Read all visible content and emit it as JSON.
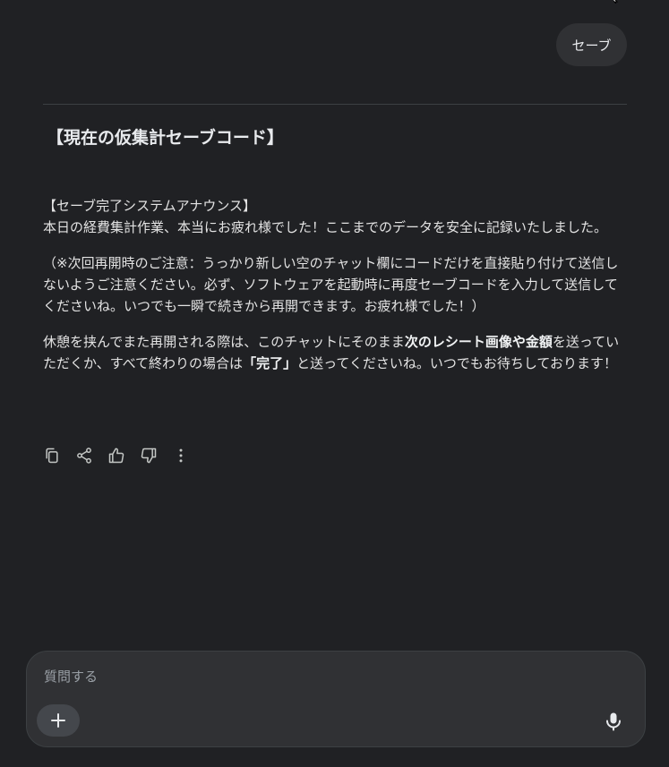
{
  "user_message": {
    "text": "セーブ"
  },
  "response": {
    "heading": "【現在の仮集計セーブコード】",
    "announce_title": "【セーブ完了システムアナウンス】",
    "announce_body": "本日の経費集計作業、本当にお疲れ様でした！ここまでのデータを安全に記録いたしました。",
    "note": "（※次回再開時のご注意：うっかり新しい空のチャット欄にコードだけを直接貼り付けて送信しないようご注意ください。必ず、ソフトウェアを起動時に再度セーブコードを入力して送信してくださいね。いつでも一瞬で続きから再開できます。お疲れ様でした！）",
    "closing": {
      "part1": "休憩を挟んでまた再開される際は、このチャットにそのまま",
      "bold1": "次のレシート画像や金額",
      "part2": "を送っていただくか、すべて終わりの場合は",
      "bold2": "「完了」",
      "part3": "と送ってくださいね。いつでもお待ちしております！"
    }
  },
  "actions": {
    "icons": [
      "copy-icon",
      "share-icon",
      "thumbs-up-icon",
      "thumbs-down-icon",
      "more-vertical-icon"
    ]
  },
  "input": {
    "placeholder": "質問する",
    "value": "",
    "add_icon": "plus-icon",
    "mic_icon": "microphone-icon"
  },
  "colors": {
    "background": "#202124",
    "bubble": "#303134",
    "input_bg": "#303134",
    "plus_bg": "#44474c",
    "text": "#e8eaed",
    "muted": "#9aa0a6"
  }
}
